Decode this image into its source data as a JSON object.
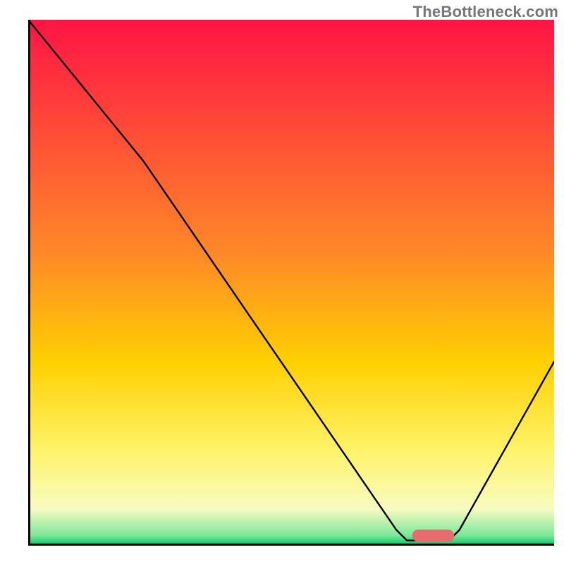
{
  "watermark": "TheBottleneck.com",
  "chart_data": {
    "type": "line",
    "title": "",
    "xlabel": "",
    "ylabel": "",
    "xlim": [
      0,
      100
    ],
    "ylim": [
      0,
      100
    ],
    "background_gradient": [
      {
        "offset": 0,
        "color": "#ff1445"
      },
      {
        "offset": 45,
        "color": "#ff8a27"
      },
      {
        "offset": 65,
        "color": "#ffd000"
      },
      {
        "offset": 82,
        "color": "#fff36a"
      },
      {
        "offset": 93,
        "color": "#f8fbc1"
      },
      {
        "offset": 98,
        "color": "#7de89a"
      },
      {
        "offset": 100,
        "color": "#00c65c"
      }
    ],
    "curve": [
      {
        "x": 0,
        "y": 100
      },
      {
        "x": 22,
        "y": 73
      },
      {
        "x": 70,
        "y": 3
      },
      {
        "x": 72,
        "y": 1
      },
      {
        "x": 80,
        "y": 1
      },
      {
        "x": 82,
        "y": 3
      },
      {
        "x": 100,
        "y": 35
      }
    ],
    "marker": {
      "x_start": 73,
      "x_end": 81,
      "y": 1.9,
      "color": "#e96a6f",
      "thickness": 2.3
    },
    "axes": {
      "color": "#000000",
      "width": 3
    }
  }
}
